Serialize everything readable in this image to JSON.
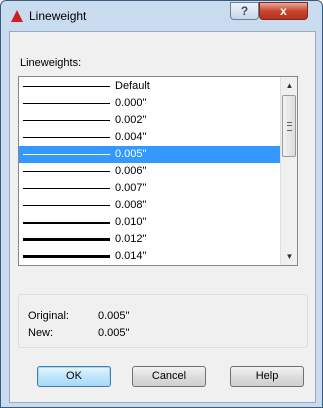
{
  "window": {
    "title": "Lineweight",
    "help_caption": "?",
    "close_caption": "x"
  },
  "list": {
    "label": "Lineweights:",
    "items": [
      {
        "label": "Default",
        "selected": false
      },
      {
        "label": "0.000\"",
        "selected": false
      },
      {
        "label": "0.002\"",
        "selected": false
      },
      {
        "label": "0.004\"",
        "selected": false
      },
      {
        "label": "0.005\"",
        "selected": true
      },
      {
        "label": "0.006\"",
        "selected": false
      },
      {
        "label": "0.007\"",
        "selected": false
      },
      {
        "label": "0.008\"",
        "selected": false
      },
      {
        "label": "0.010\"",
        "selected": false
      },
      {
        "label": "0.012\"",
        "selected": false
      },
      {
        "label": "0.014\"",
        "selected": false
      }
    ]
  },
  "info": {
    "original_label": "Original:",
    "original_value": "0.005\"",
    "new_label": "New:",
    "new_value": "0.005\""
  },
  "buttons": {
    "ok": "OK",
    "cancel": "Cancel",
    "help": "Help"
  },
  "colors": {
    "selection": "#3399ff",
    "app_icon": "#cc1f1f"
  }
}
